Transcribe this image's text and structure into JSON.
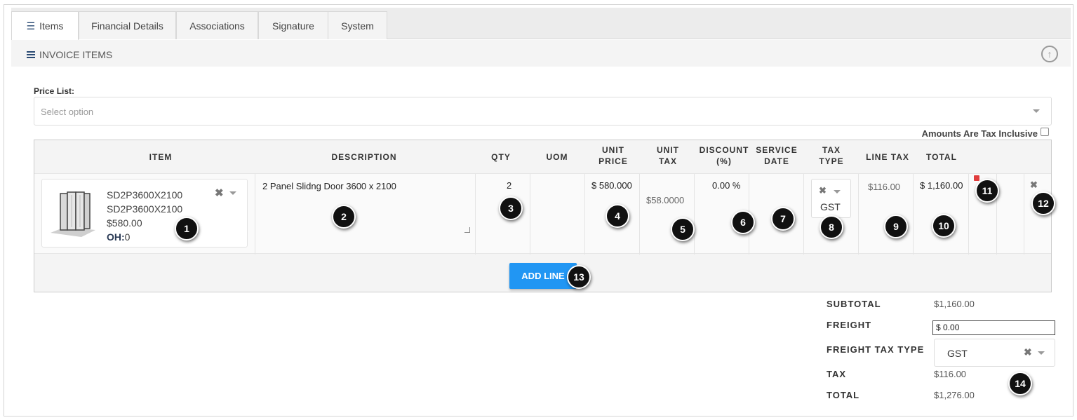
{
  "tabs": [
    {
      "label": "Items",
      "icon": "list-icon",
      "active": true
    },
    {
      "label": "Financial Details"
    },
    {
      "label": "Associations"
    },
    {
      "label": "Signature"
    },
    {
      "label": "System"
    }
  ],
  "section": {
    "title": "INVOICE ITEMS",
    "collapse_icon": "arrow-up-circle-icon"
  },
  "price_list": {
    "label": "Price List:",
    "placeholder": "Select option"
  },
  "tax_inclusive": {
    "label": "Amounts Are Tax Inclusive",
    "checked": false
  },
  "table": {
    "headers": {
      "item": "ITEM",
      "description": "DESCRIPTION",
      "qty": "QTY",
      "uom": "UOM",
      "unit_price_1": "UNIT",
      "unit_price_2": "PRICE",
      "unit_tax_1": "UNIT",
      "unit_tax_2": "TAX",
      "discount_1": "DISCOUNT",
      "discount_2": "(%)",
      "service_1": "SERVICE",
      "service_2": "DATE",
      "tax_type_1": "TAX",
      "tax_type_2": "TYPE",
      "line_tax": "LINE TAX",
      "total": "TOTAL"
    },
    "row": {
      "item_code": "SD2P3600X2100",
      "item_name": "SD2P3600X2100",
      "item_price": "$580.00",
      "oh_label": "OH:",
      "oh_value": "0",
      "description": "2 Panel Slidng Door 3600 x 2100",
      "qty": "2",
      "uom": "",
      "unit_price": "$ 580.000",
      "unit_tax": "$58.0000",
      "discount": "0.00 %",
      "service_date": "",
      "tax_type": "GST",
      "line_tax": "$116.00",
      "total": "$ 1,160.00"
    }
  },
  "buttons": {
    "add_line": "ADD LINE"
  },
  "totals": {
    "subtotal_label": "SUBTOTAL",
    "subtotal": "$1,160.00",
    "freight_label": "FREIGHT",
    "freight_value": "$ 0.00",
    "freight_tax_type_label": "FREIGHT TAX TYPE",
    "freight_tax_type": "GST",
    "tax_label": "TAX",
    "tax": "$116.00",
    "total_label": "TOTAL",
    "total": "$1,276.00"
  },
  "callouts": [
    "1",
    "2",
    "3",
    "4",
    "5",
    "6",
    "7",
    "8",
    "9",
    "10",
    "11",
    "12",
    "13",
    "14"
  ],
  "colors": {
    "accent": "#2196f3",
    "callout_bg": "#111111",
    "nav_icon": "#2a4a73",
    "error_badge": "#e03c3c"
  }
}
